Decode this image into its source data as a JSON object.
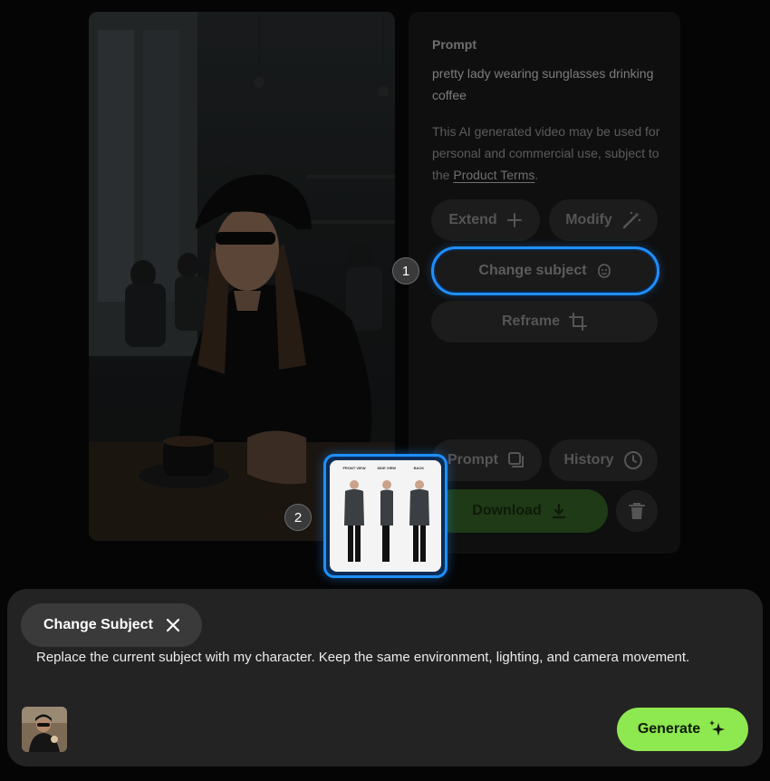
{
  "side_panel": {
    "prompt_heading": "Prompt",
    "prompt_text": "pretty lady wearing sunglasses drinking coffee",
    "terms_text_before": "This AI generated video may be used for personal and commercial use, subject to the ",
    "terms_link": "Product Terms",
    "terms_text_after": ".",
    "buttons": {
      "extend": "Extend",
      "modify": "Modify",
      "change_subject": "Change subject",
      "reframe": "Reframe",
      "prompt": "Prompt",
      "history": "History",
      "download": "Download"
    }
  },
  "badges": {
    "step_1": "1",
    "step_2": "2"
  },
  "reference_image": {
    "labels": [
      "FRONT VIEW",
      "SIDE VIEW",
      "BACK"
    ]
  },
  "composer": {
    "mode_label": "Change Subject",
    "text": "Replace the current subject with my character. Keep the same environment, lighting, and camera movement.",
    "generate_label": "Generate"
  },
  "colors": {
    "accent_blue": "#1f8fff",
    "generate_green": "#8ee84f",
    "download_green": "#1f3a16"
  },
  "icons": {
    "extend": "plus-icon",
    "modify": "magic-wand-icon",
    "change_subject": "face-icon",
    "reframe": "crop-icon",
    "prompt": "copy-icon",
    "history": "clock-icon",
    "download": "download-icon",
    "delete": "trash-icon",
    "close_mode": "close-icon",
    "generate": "sparkle-icon"
  }
}
